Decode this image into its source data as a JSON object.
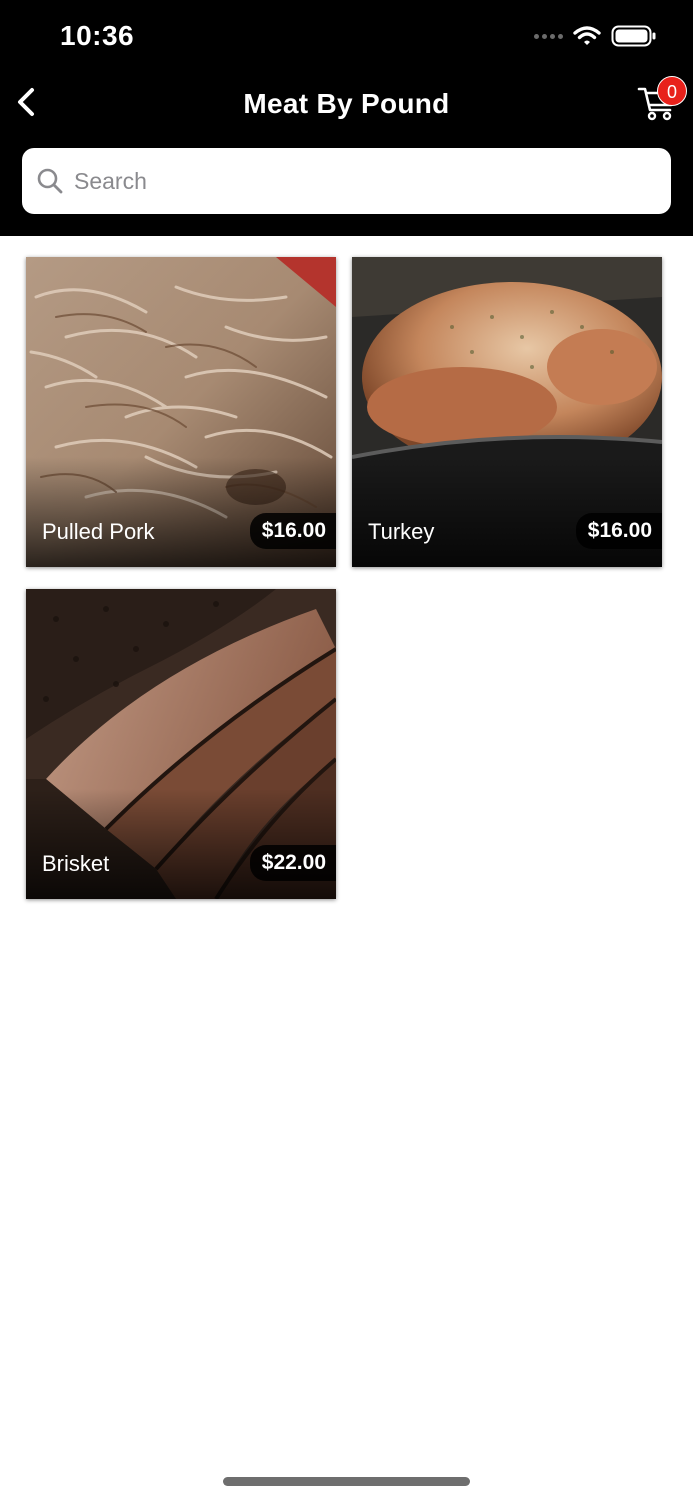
{
  "status_bar": {
    "time": "10:36"
  },
  "header": {
    "title": "Meat By Pound",
    "cart_count": "0"
  },
  "search": {
    "placeholder": "Search",
    "value": ""
  },
  "products": [
    {
      "name": "Pulled Pork",
      "price": "$16.00"
    },
    {
      "name": "Turkey",
      "price": "$16.00"
    },
    {
      "name": "Brisket",
      "price": "$22.00"
    }
  ],
  "colors": {
    "header_bg": "#000000",
    "badge": "#e8211b",
    "page_bg": "#ffffff"
  },
  "icons": [
    "back-chevron-icon",
    "cart-icon",
    "search-icon",
    "wifi-icon",
    "battery-icon"
  ]
}
